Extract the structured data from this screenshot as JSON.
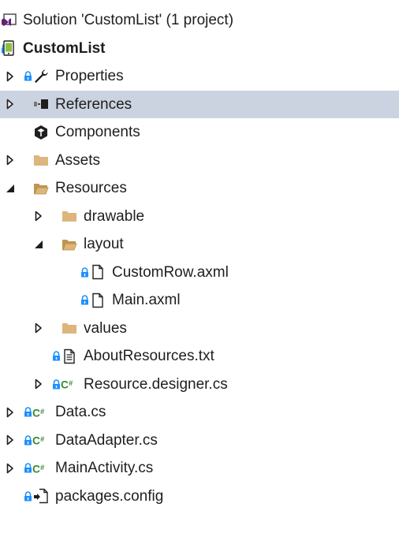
{
  "solution_explorer": {
    "items": [
      {
        "label": "Solution 'CustomList' (1 project)",
        "icon": "solution-icon",
        "depth": 0,
        "expander": "none",
        "lock": false,
        "bold": false,
        "selected": false
      },
      {
        "label": "CustomList",
        "icon": "android-project-icon",
        "depth": 0,
        "expander": "expanded",
        "lock": true,
        "bold": true,
        "selected": false
      },
      {
        "label": "Properties",
        "icon": "wrench-icon",
        "depth": 1,
        "expander": "collapsed",
        "lock": true,
        "bold": false,
        "selected": false
      },
      {
        "label": "References",
        "icon": "references-icon",
        "depth": 1,
        "expander": "collapsed",
        "lock": false,
        "bold": false,
        "selected": true
      },
      {
        "label": "Components",
        "icon": "components-icon",
        "depth": 1,
        "expander": "none",
        "lock": false,
        "bold": false,
        "selected": false
      },
      {
        "label": "Assets",
        "icon": "folder-icon",
        "depth": 1,
        "expander": "collapsed",
        "lock": false,
        "bold": false,
        "selected": false
      },
      {
        "label": "Resources",
        "icon": "folder-open-icon",
        "depth": 1,
        "expander": "expanded",
        "lock": false,
        "bold": false,
        "selected": false
      },
      {
        "label": "drawable",
        "icon": "folder-icon",
        "depth": 2,
        "expander": "collapsed",
        "lock": false,
        "bold": false,
        "selected": false
      },
      {
        "label": "layout",
        "icon": "folder-open-icon",
        "depth": 2,
        "expander": "expanded",
        "lock": false,
        "bold": false,
        "selected": false
      },
      {
        "label": "CustomRow.axml",
        "icon": "file-icon",
        "depth": 3,
        "expander": "none",
        "lock": true,
        "bold": false,
        "selected": false
      },
      {
        "label": "Main.axml",
        "icon": "file-icon",
        "depth": 3,
        "expander": "none",
        "lock": true,
        "bold": false,
        "selected": false
      },
      {
        "label": "values",
        "icon": "folder-icon",
        "depth": 2,
        "expander": "collapsed",
        "lock": false,
        "bold": false,
        "selected": false
      },
      {
        "label": "AboutResources.txt",
        "icon": "text-file-icon",
        "depth": 2,
        "expander": "none",
        "lock": true,
        "bold": false,
        "selected": false
      },
      {
        "label": "Resource.designer.cs",
        "icon": "csharp-icon",
        "depth": 2,
        "expander": "collapsed",
        "lock": true,
        "bold": false,
        "selected": false
      },
      {
        "label": "Data.cs",
        "icon": "csharp-icon",
        "depth": 1,
        "expander": "collapsed",
        "lock": true,
        "bold": false,
        "selected": false
      },
      {
        "label": "DataAdapter.cs",
        "icon": "csharp-icon",
        "depth": 1,
        "expander": "collapsed",
        "lock": true,
        "bold": false,
        "selected": false
      },
      {
        "label": "MainActivity.cs",
        "icon": "csharp-icon",
        "depth": 1,
        "expander": "collapsed",
        "lock": true,
        "bold": false,
        "selected": false
      },
      {
        "label": "packages.config",
        "icon": "config-file-icon",
        "depth": 1,
        "expander": "none",
        "lock": true,
        "bold": false,
        "selected": false
      }
    ]
  },
  "colors": {
    "selection_bg": "#ccd3e0",
    "folder": "#dcb67a",
    "lock": "#1e90ff",
    "csharp": "#388a34",
    "solution": "#68217a"
  }
}
